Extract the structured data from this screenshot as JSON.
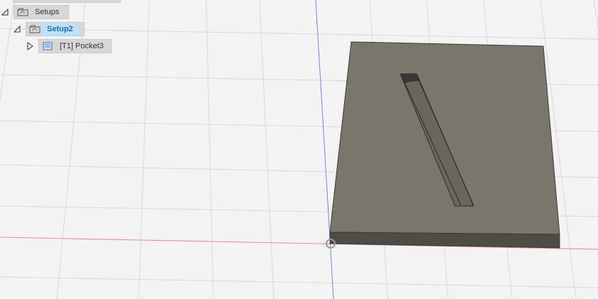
{
  "browser_tree": {
    "setups": {
      "label": "Setups",
      "icon": "setups-folder-icon",
      "expanded": true
    },
    "setup2": {
      "label": "Setup2",
      "icon": "setup-icon",
      "expanded": true,
      "selected": true
    },
    "operation": {
      "label": "[T1] Pocket3",
      "icon": "pocket-toolpath-icon",
      "expanded": false
    }
  },
  "colors": {
    "background": "#f3f3f3",
    "grid_line": "#d8d8d8",
    "x_axis": "#e58a8a",
    "y_axis": "#7f7fe0",
    "stock_top": "#7a766c",
    "stock_side": "#4e4c46",
    "selection_highlight": "#bfe0fb"
  }
}
